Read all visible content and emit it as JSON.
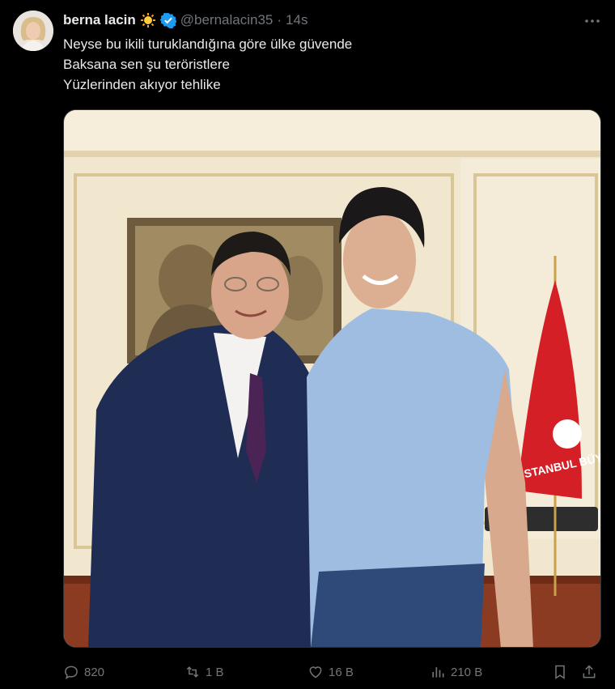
{
  "tweet": {
    "display_name": "berna lacin",
    "handle": "@bernalacin35",
    "separator": "·",
    "time": "14s",
    "lines": [
      "Neyse bu ikili turuklandığına göre ülke güvende",
      "Baksana sen şu teröristlere",
      "Yüzlerinden akıyor tehlike"
    ]
  },
  "media": {
    "flag_text": "İSTANBUL BÜYÜKŞEHİR"
  },
  "actions": {
    "replies": "820",
    "reposts": "1 B",
    "likes": "16 B",
    "views": "210 B"
  },
  "icons": {
    "verified": "verified-badge-icon",
    "sun": "sun-emoji-icon",
    "more": "more-dots-icon",
    "reply": "reply-icon",
    "repost": "repost-icon",
    "like": "heart-icon",
    "views": "views-bar-chart-icon",
    "bookmark": "bookmark-icon",
    "share": "share-icon"
  },
  "colors": {
    "background": "#000000",
    "text": "#e7e9ea",
    "muted": "#71767b",
    "verified": "#1d9bf0"
  }
}
